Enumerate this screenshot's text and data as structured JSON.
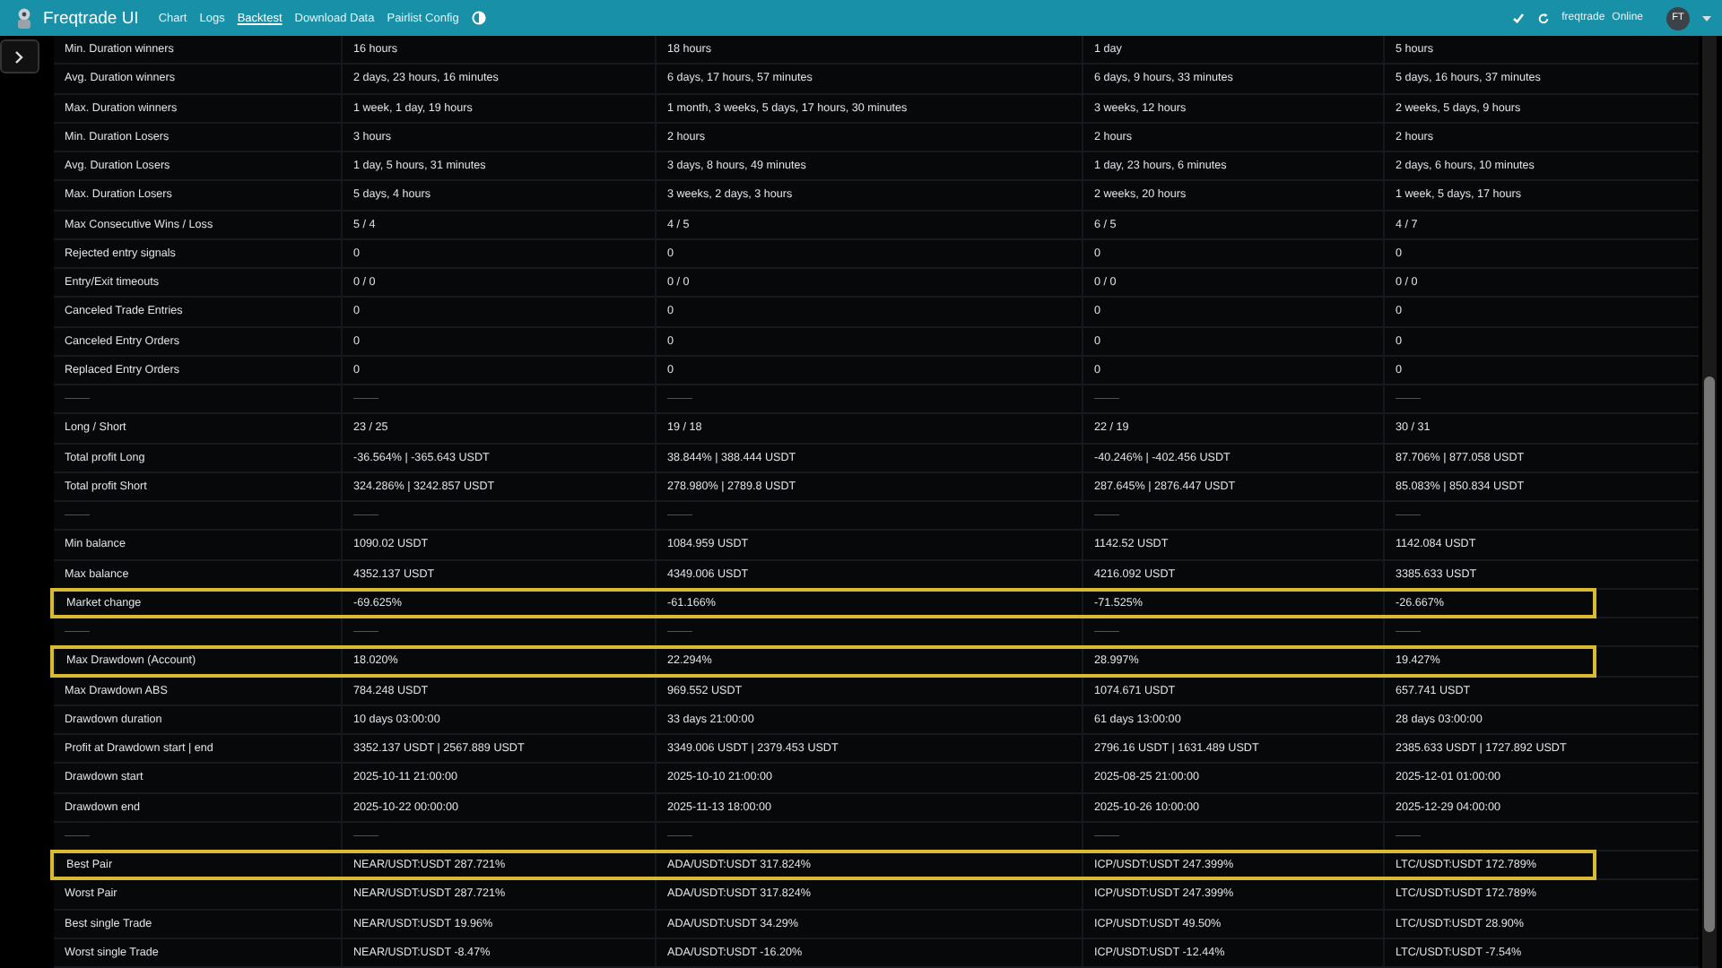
{
  "navbar": {
    "brand": "Freqtrade UI",
    "links": [
      {
        "label": "Chart",
        "selected": false
      },
      {
        "label": "Logs",
        "selected": false
      },
      {
        "label": "Backtest",
        "selected": true
      },
      {
        "label": "Download Data",
        "selected": false
      },
      {
        "label": "Pairlist Config",
        "selected": false
      }
    ],
    "bot_name": "freqtrade",
    "bot_status": "Online",
    "avatar": "FT"
  },
  "table": {
    "rows": [
      {
        "kind": "data",
        "highlighted": false,
        "cells": [
          "Min. Duration winners",
          "16 hours",
          "18 hours",
          "1 day",
          "5 hours"
        ]
      },
      {
        "kind": "data",
        "highlighted": false,
        "cells": [
          "Avg. Duration winners",
          "2 days, 23 hours, 16 minutes",
          "6 days, 17 hours, 57 minutes",
          "6 days, 9 hours, 33 minutes",
          "5 days, 16 hours, 37 minutes"
        ]
      },
      {
        "kind": "data",
        "highlighted": false,
        "cells": [
          "Max. Duration winners",
          "1 week, 1 day, 19 hours",
          "1 month, 3 weeks, 5 days, 17 hours, 30 minutes",
          "3 weeks, 12 hours",
          "2 weeks, 5 days, 9 hours"
        ]
      },
      {
        "kind": "data",
        "highlighted": false,
        "cells": [
          "Min. Duration Losers",
          "3 hours",
          "2 hours",
          "2 hours",
          "2 hours"
        ]
      },
      {
        "kind": "data",
        "highlighted": false,
        "cells": [
          "Avg. Duration Losers",
          "1 day, 5 hours, 31 minutes",
          "3 days, 8 hours, 49 minutes",
          "1 day, 23 hours, 6 minutes",
          "2 days, 6 hours, 10 minutes"
        ]
      },
      {
        "kind": "data",
        "highlighted": false,
        "cells": [
          "Max. Duration Losers",
          "5 days, 4 hours",
          "3 weeks, 2 days, 3 hours",
          "2 weeks, 20 hours",
          "1 week, 5 days, 17 hours"
        ]
      },
      {
        "kind": "data",
        "highlighted": false,
        "cells": [
          "Max Consecutive Wins / Loss",
          "5 / 4",
          "4 / 5",
          "6 / 5",
          "4 / 7"
        ]
      },
      {
        "kind": "data",
        "highlighted": false,
        "cells": [
          "Rejected entry signals",
          "0",
          "0",
          "0",
          "0"
        ]
      },
      {
        "kind": "data",
        "highlighted": false,
        "cells": [
          "Entry/Exit timeouts",
          "0 / 0",
          "0 / 0",
          "0 / 0",
          "0 / 0"
        ]
      },
      {
        "kind": "data",
        "highlighted": false,
        "cells": [
          "Canceled Trade Entries",
          "0",
          "0",
          "0",
          "0"
        ]
      },
      {
        "kind": "data",
        "highlighted": false,
        "cells": [
          "Canceled Entry Orders",
          "0",
          "0",
          "0",
          "0"
        ]
      },
      {
        "kind": "data",
        "highlighted": false,
        "cells": [
          "Replaced Entry Orders",
          "0",
          "0",
          "0",
          "0"
        ]
      },
      {
        "kind": "separator",
        "highlighted": false,
        "cells": [
          "——",
          "——",
          "——",
          "——",
          "——"
        ]
      },
      {
        "kind": "data",
        "highlighted": false,
        "cells": [
          "Long / Short",
          "23 / 25",
          "19 / 18",
          "22 / 19",
          "30 / 31"
        ]
      },
      {
        "kind": "data",
        "highlighted": false,
        "cells": [
          "Total profit Long",
          "-36.564% | -365.643 USDT",
          "38.844% | 388.444 USDT",
          "-40.246% | -402.456 USDT",
          "87.706% | 877.058 USDT"
        ]
      },
      {
        "kind": "data",
        "highlighted": false,
        "cells": [
          "Total profit Short",
          "324.286% | 3242.857 USDT",
          "278.980% | 2789.8 USDT",
          "287.645% | 2876.447 USDT",
          "85.083% | 850.834 USDT"
        ]
      },
      {
        "kind": "separator",
        "highlighted": false,
        "cells": [
          "——",
          "——",
          "——",
          "——",
          "——"
        ]
      },
      {
        "kind": "data",
        "highlighted": false,
        "cells": [
          "Min balance",
          "1090.02 USDT",
          "1084.959 USDT",
          "1142.52 USDT",
          "1142.084 USDT"
        ]
      },
      {
        "kind": "data",
        "highlighted": false,
        "cells": [
          "Max balance",
          "4352.137 USDT",
          "4349.006 USDT",
          "4216.092 USDT",
          "3385.633 USDT"
        ]
      },
      {
        "kind": "data",
        "highlighted": true,
        "cells": [
          "Market change",
          "-69.625%",
          "-61.166%",
          "-71.525%",
          "-26.667%"
        ]
      },
      {
        "kind": "separator",
        "highlighted": false,
        "cells": [
          "——",
          "——",
          "——",
          "——",
          "——"
        ]
      },
      {
        "kind": "data",
        "highlighted": true,
        "cells": [
          "Max Drawdown (Account)",
          "18.020%",
          "22.294%",
          "28.997%",
          "19.427%"
        ]
      },
      {
        "kind": "data",
        "highlighted": false,
        "cells": [
          "Max Drawdown ABS",
          "784.248 USDT",
          "969.552 USDT",
          "1074.671 USDT",
          "657.741 USDT"
        ]
      },
      {
        "kind": "data",
        "highlighted": false,
        "cells": [
          "Drawdown duration",
          "10 days 03:00:00",
          "33 days 21:00:00",
          "61 days 13:00:00",
          "28 days 03:00:00"
        ]
      },
      {
        "kind": "data",
        "highlighted": false,
        "cells": [
          "Profit at Drawdown start | end",
          "3352.137 USDT | 2567.889 USDT",
          "3349.006 USDT | 2379.453 USDT",
          "2796.16 USDT | 1631.489 USDT",
          "2385.633 USDT | 1727.892 USDT"
        ]
      },
      {
        "kind": "data",
        "highlighted": false,
        "cells": [
          "Drawdown start",
          "2025-10-11 21:00:00",
          "2025-10-10 21:00:00",
          "2025-08-25 21:00:00",
          "2025-12-01 01:00:00"
        ]
      },
      {
        "kind": "data",
        "highlighted": false,
        "cells": [
          "Drawdown end",
          "2025-10-22 00:00:00",
          "2025-11-13 18:00:00",
          "2025-10-26 10:00:00",
          "2025-12-29 04:00:00"
        ]
      },
      {
        "kind": "separator",
        "highlighted": false,
        "cells": [
          "——",
          "——",
          "——",
          "——",
          "——"
        ]
      },
      {
        "kind": "data",
        "highlighted": true,
        "cells": [
          "Best Pair",
          "NEAR/USDT:USDT 287.721%",
          "ADA/USDT:USDT 317.824%",
          "ICP/USDT:USDT 247.399%",
          "LTC/USDT:USDT 172.789%"
        ]
      },
      {
        "kind": "data",
        "highlighted": false,
        "cells": [
          "Worst Pair",
          "NEAR/USDT:USDT 287.721%",
          "ADA/USDT:USDT 317.824%",
          "ICP/USDT:USDT 247.399%",
          "LTC/USDT:USDT 172.789%"
        ]
      },
      {
        "kind": "data",
        "highlighted": false,
        "cells": [
          "Best single Trade",
          "NEAR/USDT:USDT 19.96%",
          "ADA/USDT:USDT 34.29%",
          "ICP/USDT:USDT 49.50%",
          "LTC/USDT:USDT 28.90%"
        ]
      },
      {
        "kind": "data",
        "highlighted": false,
        "cells": [
          "Worst single Trade",
          "NEAR/USDT:USDT -8.47%",
          "ADA/USDT:USDT -16.20%",
          "ICP/USDT:USDT -12.44%",
          "LTC/USDT:USDT -7.54%"
        ]
      }
    ]
  }
}
